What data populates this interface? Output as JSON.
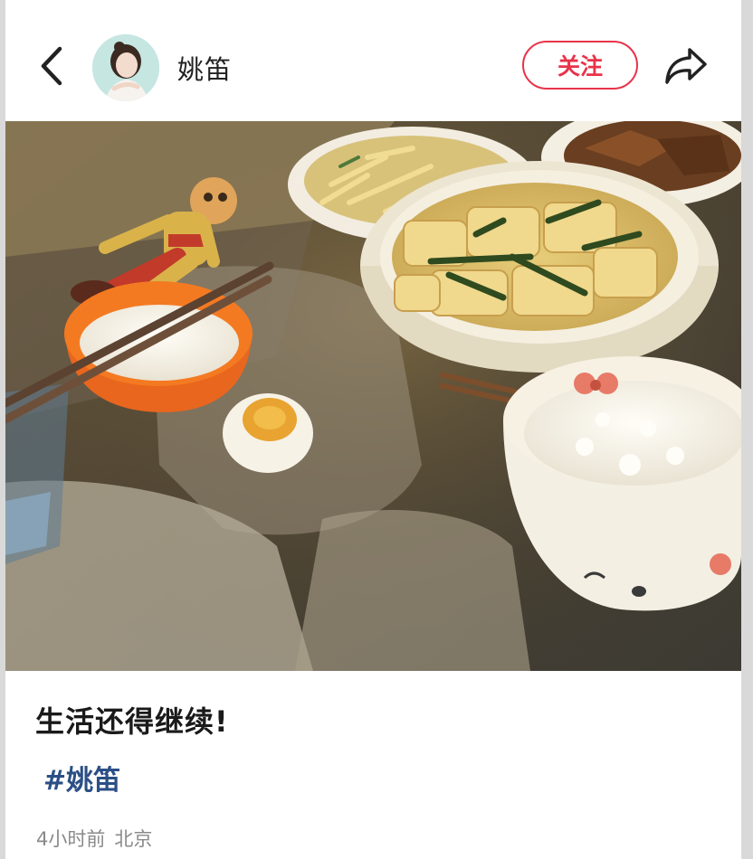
{
  "header": {
    "author_name": "姚笛",
    "follow_label": "关注",
    "back_icon": "chevron-left-icon",
    "share_icon": "share-arrow-icon"
  },
  "post": {
    "photo": "dinner table with rice bowls, tofu soup, stir-fried dishes, salted egg",
    "caption": "生活还得继续!",
    "hashtag": "#姚笛",
    "time": "4小时前",
    "location": "北京"
  },
  "colors": {
    "accent": "#e8334a",
    "hashtag": "#2b4f86",
    "meta": "#8a8a8a"
  }
}
